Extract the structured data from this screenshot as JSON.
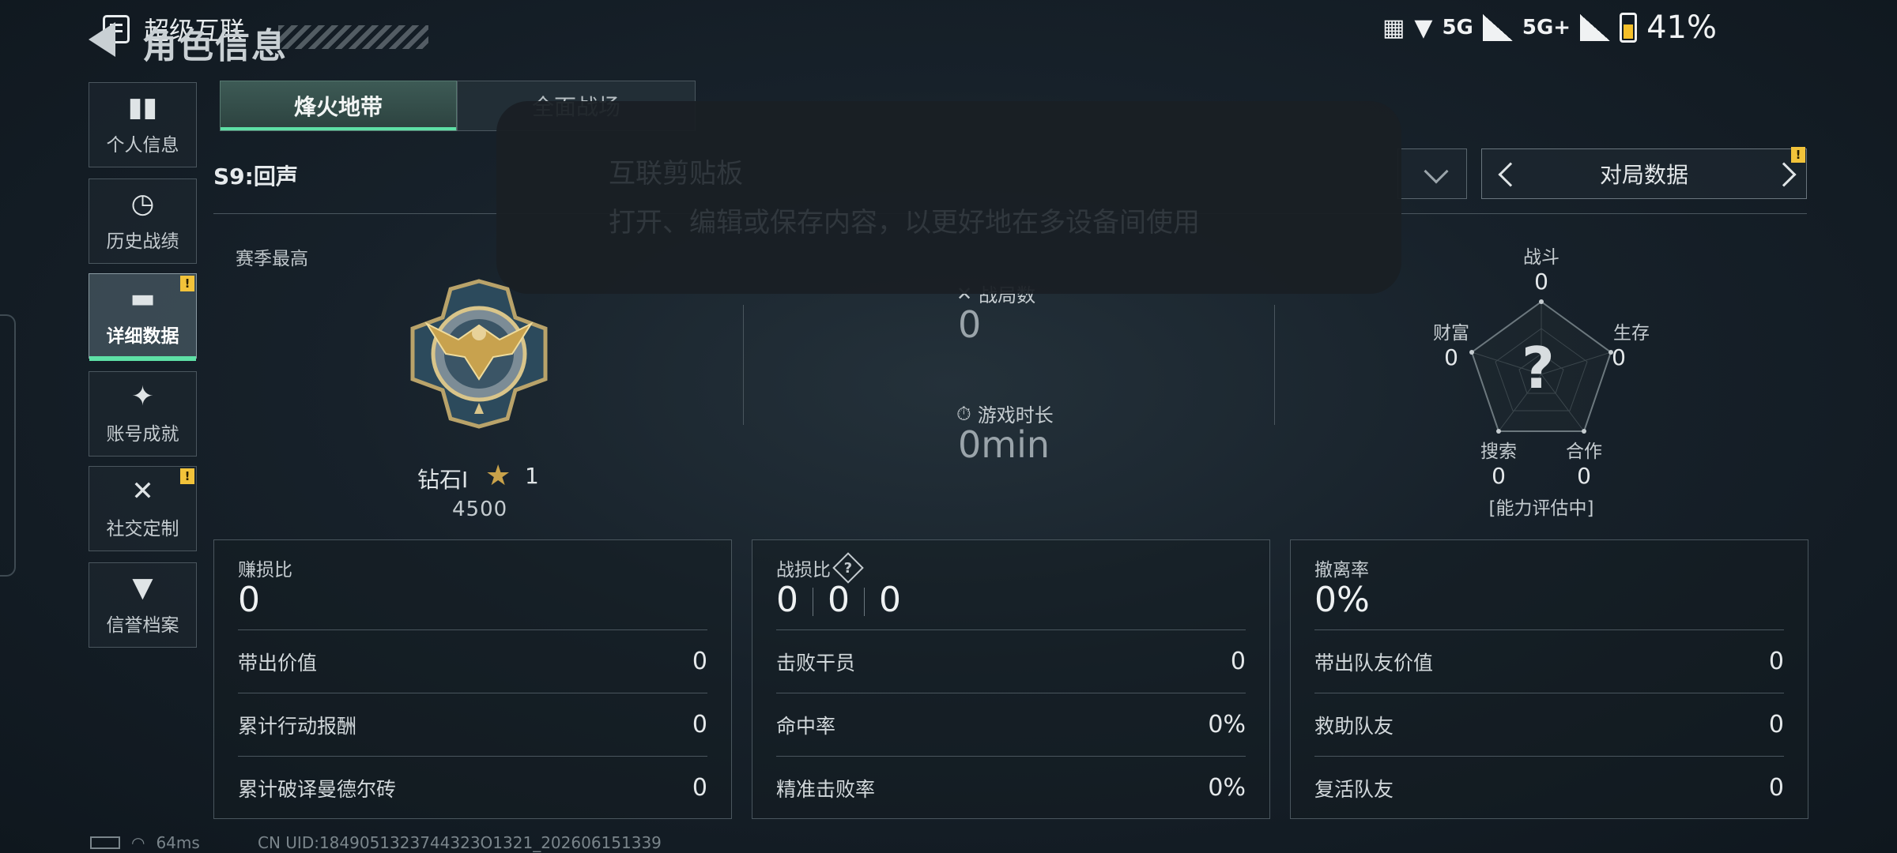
{
  "status_bar": {
    "app_name": "超级互联",
    "network_1": "5G",
    "network_2": "5G+",
    "battery": "41%"
  },
  "header": {
    "title": "角色信息"
  },
  "sidebar": {
    "items": [
      {
        "label": "个人信息",
        "icon": "bar-chart-icon",
        "active": false,
        "badge": ""
      },
      {
        "label": "历史战绩",
        "icon": "history-icon",
        "active": false,
        "badge": ""
      },
      {
        "label": "详细数据",
        "icon": "folder-icon",
        "active": true,
        "badge": "!"
      },
      {
        "label": "账号成就",
        "icon": "achievement-icon",
        "active": false,
        "badge": ""
      },
      {
        "label": "社交定制",
        "icon": "tools-icon",
        "active": false,
        "badge": "!"
      },
      {
        "label": "信誉档案",
        "icon": "shield-icon",
        "active": false,
        "badge": ""
      }
    ]
  },
  "tabs": [
    {
      "label": "烽火地带",
      "active": true
    },
    {
      "label": "全面战场",
      "active": false
    }
  ],
  "season": "S9:回声",
  "selector": {
    "label": "对局数据",
    "badge": "!"
  },
  "rank": {
    "label": "赛季最高",
    "name": "钻石I",
    "stars": "1",
    "score": "4500"
  },
  "middle_stats": {
    "matches_label": "战局数",
    "matches_value": "0",
    "playtime_label": "游戏时长",
    "playtime_value": "0min"
  },
  "radar": {
    "axes": [
      {
        "label": "战斗",
        "value": "0"
      },
      {
        "label": "生存",
        "value": "0"
      },
      {
        "label": "合作",
        "value": "0"
      },
      {
        "label": "搜索",
        "value": "0"
      },
      {
        "label": "财富",
        "value": "0"
      }
    ],
    "center_symbol": "?",
    "status": "[能力评估中]"
  },
  "panels": {
    "profit": {
      "title": "赚损比",
      "value": "0",
      "rows": [
        {
          "label": "带出价值",
          "value": "0"
        },
        {
          "label": "累计行动报酬",
          "value": "0"
        },
        {
          "label": "累计破译曼德尔砖",
          "value": "0"
        }
      ]
    },
    "combat": {
      "title": "战损比",
      "help": "?",
      "kills": "0",
      "deaths": "0",
      "assists": "0",
      "rows": [
        {
          "label": "击败干员",
          "value": "0"
        },
        {
          "label": "命中率",
          "value": "0%"
        },
        {
          "label": "精准击败率",
          "value": "0%"
        }
      ]
    },
    "extract": {
      "title": "撤离率",
      "value": "0%",
      "rows": [
        {
          "label": "带出队友价值",
          "value": "0"
        },
        {
          "label": "救助队友",
          "value": "0"
        },
        {
          "label": "复活队友",
          "value": "0"
        }
      ]
    }
  },
  "overlay": {
    "line1": "互联剪贴板",
    "line2": "打开、编辑或保存内容，以更好地在多设备间使用"
  },
  "footer": {
    "ping": "64ms",
    "uid": "CN UID:1849051323744323O1321_202606151339"
  },
  "colors": {
    "accent": "#5ee0a6",
    "warning": "#f2c33a",
    "rank_gold": "#c9a24a"
  }
}
